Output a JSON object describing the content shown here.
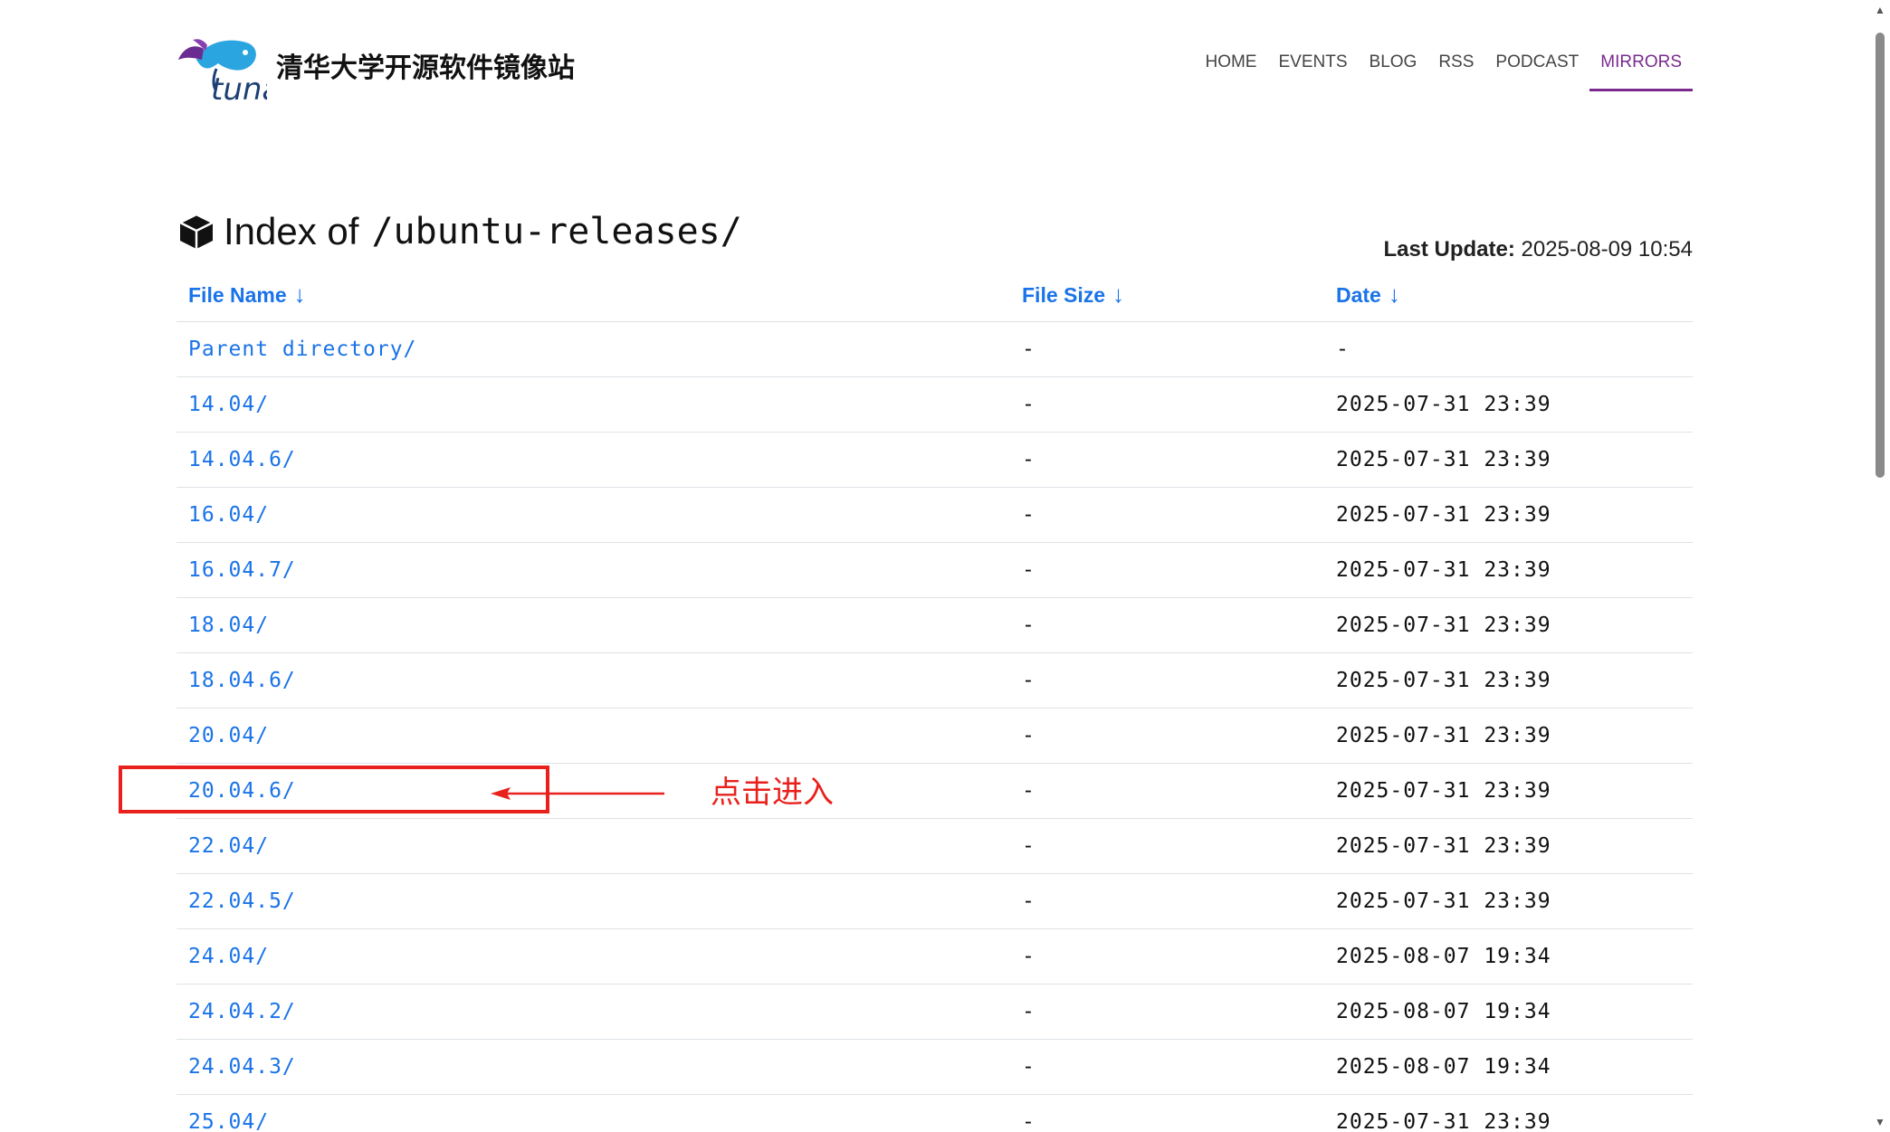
{
  "header": {
    "logo_text": "tuna",
    "site_title": "清华大学开源软件镜像站",
    "nav": [
      {
        "label": "HOME"
      },
      {
        "label": "EVENTS"
      },
      {
        "label": "BLOG"
      },
      {
        "label": "RSS"
      },
      {
        "label": "PODCAST"
      },
      {
        "label": "MIRRORS"
      }
    ],
    "active_nav": "MIRRORS"
  },
  "index": {
    "prefix": "Index of",
    "path": "/ubuntu-releases/",
    "last_update_label": "Last Update:",
    "last_update_value": "2025-08-09 10:54"
  },
  "table": {
    "columns": [
      {
        "label": "File Name",
        "arrow": "↓"
      },
      {
        "label": "File Size",
        "arrow": "↓"
      },
      {
        "label": "Date",
        "arrow": "↓"
      }
    ],
    "rows": [
      {
        "name": "Parent directory/",
        "size": "-",
        "date": "-"
      },
      {
        "name": "14.04/",
        "size": "-",
        "date": "2025-07-31 23:39"
      },
      {
        "name": "14.04.6/",
        "size": "-",
        "date": "2025-07-31 23:39"
      },
      {
        "name": "16.04/",
        "size": "-",
        "date": "2025-07-31 23:39"
      },
      {
        "name": "16.04.7/",
        "size": "-",
        "date": "2025-07-31 23:39"
      },
      {
        "name": "18.04/",
        "size": "-",
        "date": "2025-07-31 23:39"
      },
      {
        "name": "18.04.6/",
        "size": "-",
        "date": "2025-07-31 23:39"
      },
      {
        "name": "20.04/",
        "size": "-",
        "date": "2025-07-31 23:39"
      },
      {
        "name": "20.04.6/",
        "size": "-",
        "date": "2025-07-31 23:39"
      },
      {
        "name": "22.04/",
        "size": "-",
        "date": "2025-07-31 23:39"
      },
      {
        "name": "22.04.5/",
        "size": "-",
        "date": "2025-07-31 23:39"
      },
      {
        "name": "24.04/",
        "size": "-",
        "date": "2025-08-07 19:34"
      },
      {
        "name": "24.04.2/",
        "size": "-",
        "date": "2025-08-07 19:34"
      },
      {
        "name": "24.04.3/",
        "size": "-",
        "date": "2025-08-07 19:34"
      },
      {
        "name": "25.04/",
        "size": "-",
        "date": "2025-07-31 23:39"
      }
    ]
  },
  "annotation": {
    "text": "点击进入",
    "color": "#e8211c"
  },
  "colors": {
    "link": "#1a73e8",
    "active_nav": "#7a2a8e",
    "annotation": "#e8211c"
  },
  "icons": {
    "logo": "tuna-fish-logo",
    "heading": "package-box-icon",
    "sort": "arrow-down-icon"
  }
}
